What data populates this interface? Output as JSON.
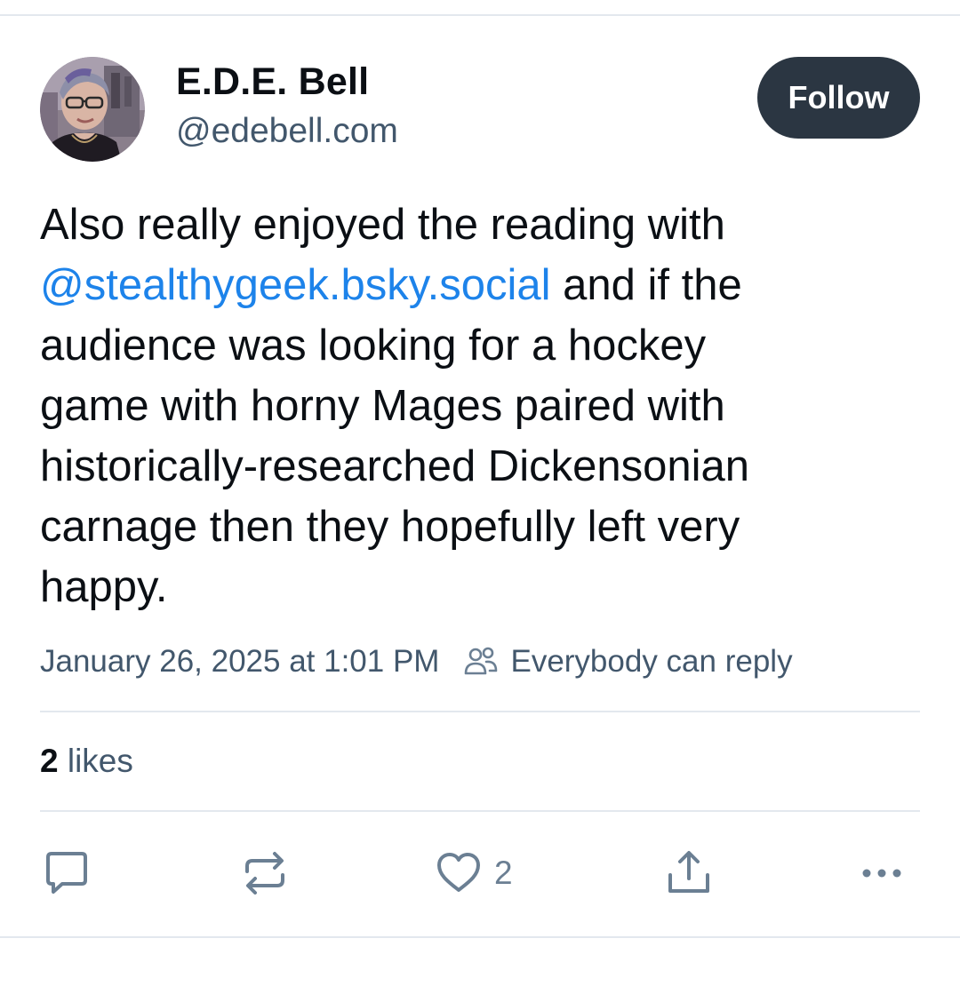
{
  "author": {
    "display_name": "E.D.E. Bell",
    "handle": "@edebell.com"
  },
  "follow_label": "Follow",
  "post": {
    "lines": [
      {
        "text": "Also really enjoyed the reading with"
      },
      {
        "mention": "@stealthygeek.bsky.social",
        "text": " and if the"
      },
      {
        "text": "audience was looking for a hockey"
      },
      {
        "text": "game with horny Mages paired with"
      },
      {
        "text": "historically-researched Dickensonian"
      },
      {
        "text": "carnage then they hopefully left very"
      },
      {
        "text": "happy."
      }
    ]
  },
  "meta": {
    "date": "January 26, 2025 at 1:01 PM",
    "reply_setting": "Everybody can reply"
  },
  "stats": {
    "likes_count": "2",
    "likes_label": " likes"
  },
  "actions": {
    "like_count": "2"
  },
  "icons": {
    "reply": "speech-bubble-icon",
    "repost": "repost-icon",
    "like": "heart-icon",
    "share": "share-icon",
    "more": "ellipsis-icon",
    "reply_setting": "people-icon"
  },
  "colors": {
    "accent_link": "#1d83ea",
    "follow_bg": "#2b3642",
    "secondary_text": "#42576c",
    "icon_gray": "#6b7f93",
    "divider": "#e3e8ee"
  }
}
